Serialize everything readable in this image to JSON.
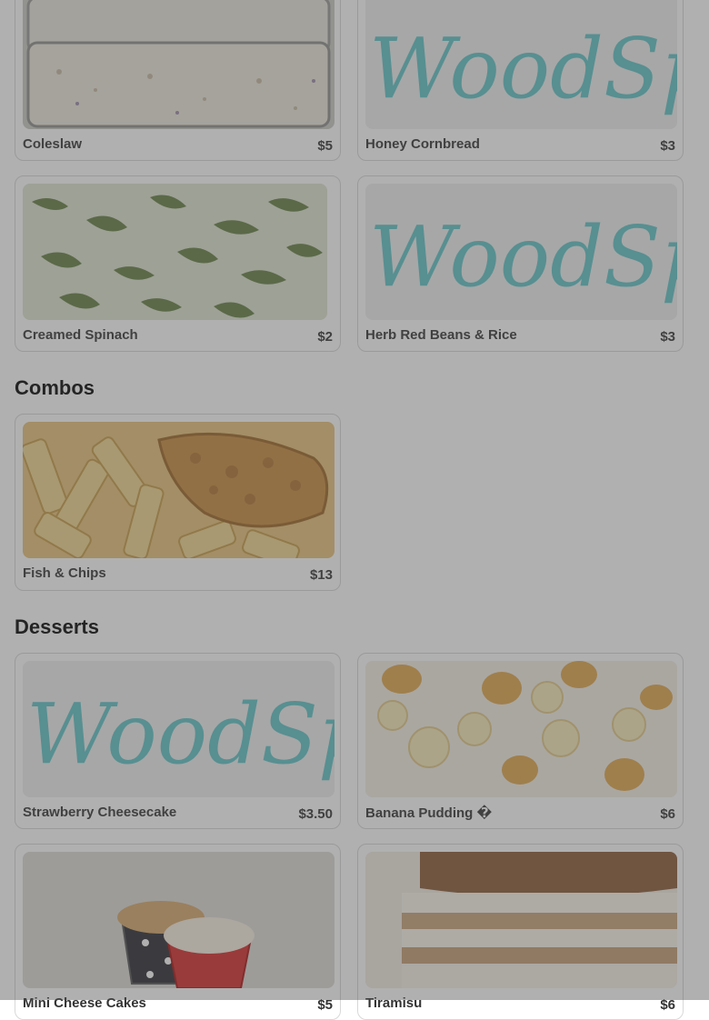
{
  "brand": {
    "logo_text": "WoodSpoon",
    "logo_color": "#5fc4c6"
  },
  "sections": {
    "combos_title": "Combos",
    "desserts_title": "Desserts"
  },
  "items": {
    "coleslaw": {
      "name": "Coleslaw",
      "price": "$5",
      "image": "coleslaw-photo"
    },
    "honey_cornbread": {
      "name": "Honey Cornbread",
      "price": "$3",
      "image": "woodspoon-logo"
    },
    "creamed_spinach": {
      "name": "Creamed Spinach",
      "price": "$2",
      "image": "creamed-spinach-photo"
    },
    "herb_red_beans": {
      "name": "Herb Red Beans & Rice",
      "price": "$3",
      "image": "woodspoon-logo"
    },
    "fish_chips": {
      "name": "Fish & Chips",
      "price": "$13",
      "image": "fish-and-chips-photo"
    },
    "strawberry_cheesecake": {
      "name": "Strawberry Cheesecake",
      "price": "$3.50",
      "image": "woodspoon-logo"
    },
    "banana_pudding": {
      "name": "Banana Pudding �",
      "price": "$6",
      "image": "banana-pudding-photo"
    },
    "mini_cheese_cakes": {
      "name": "Mini Cheese Cakes",
      "price": "$5",
      "image": "mini-cheesecakes-photo"
    },
    "tiramisu": {
      "name": "Tiramisu",
      "price": "$6",
      "image": "tiramisu-photo"
    }
  },
  "colors": {
    "overlay": "rgba(80,80,80,0.45)",
    "card_border": "#d8d8d8"
  }
}
